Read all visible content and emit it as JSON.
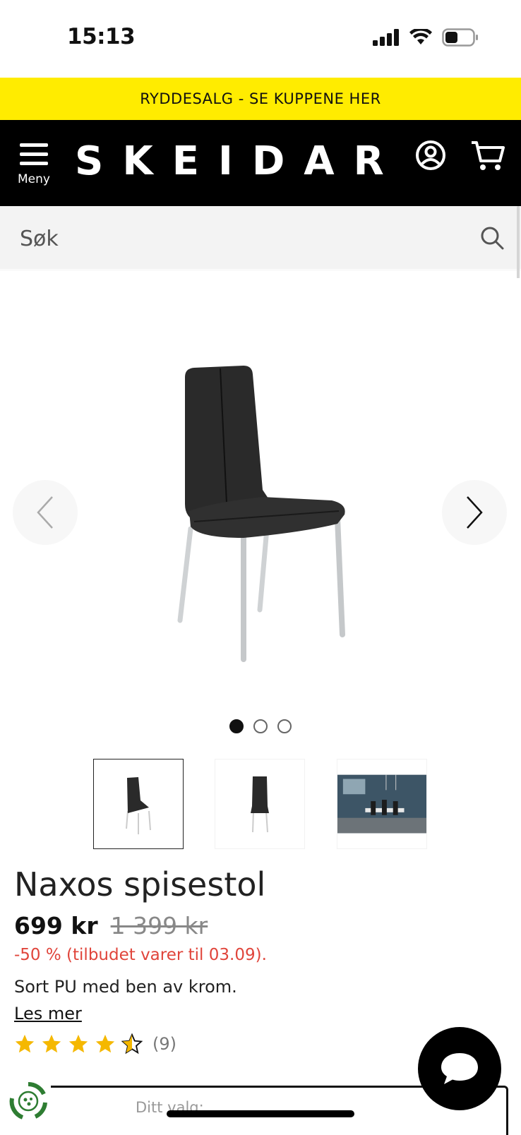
{
  "status_bar": {
    "time": "15:13"
  },
  "promo": {
    "text": "RYDDESALG - SE KUPPENE HER"
  },
  "header": {
    "menu_label": "Meny",
    "logo": "SKEIDAR"
  },
  "search": {
    "placeholder": "Søk"
  },
  "gallery": {
    "image_count": 3,
    "active_index": 0
  },
  "product": {
    "title": "Naxos spisestol",
    "price": "699 kr",
    "old_price": "1 399 kr",
    "discount": "-50 % (tilbudet varer til 03.09).",
    "description": "Sort PU med ben av krom.",
    "read_more": "Les mer",
    "rating": 4.5,
    "rating_max": 5,
    "review_count": "(9)"
  },
  "choice": {
    "label": "Ditt valg:"
  },
  "colors": {
    "promo_yellow": "#ffec00",
    "header_black": "#000000",
    "discount_red": "#e0453b",
    "star_gold": "#f5b800"
  },
  "icons": [
    "menu-icon",
    "account-icon",
    "cart-icon",
    "search-icon",
    "chevron-left-icon",
    "chevron-right-icon",
    "star-icon",
    "chat-icon",
    "recycle-icon"
  ]
}
